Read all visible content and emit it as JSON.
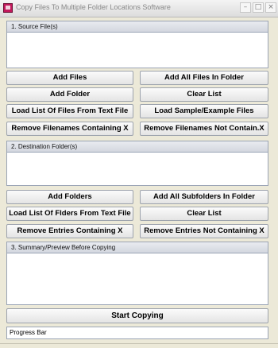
{
  "window": {
    "title": "Copy Files To Multiple Folder Locations Software",
    "controls": {
      "minimize": "–",
      "maximize": "□",
      "close": "×"
    }
  },
  "source": {
    "header": "1. Source File(s)",
    "buttons": [
      {
        "left": "Add Files",
        "right": "Add All Files In Folder"
      },
      {
        "left": "Add Folder",
        "right": "Clear List"
      },
      {
        "left": "Load List Of Files From Text File",
        "right": "Load Sample/Example Files"
      },
      {
        "left": "Remove Filenames Containing X",
        "right": "Remove Filenames Not Contain.X"
      }
    ]
  },
  "destination": {
    "header": "2. Destination Folder(s)",
    "buttons": [
      {
        "left": "Add Folders",
        "right": "Add All Subfolders In Folder"
      },
      {
        "left": "Load List Of Flders From Text File",
        "right": "Clear List"
      },
      {
        "left": "Remove Entries Containing X",
        "right": "Remove Entries Not Containing X"
      }
    ]
  },
  "summary": {
    "header": "3. Summary/Preview Before Copying"
  },
  "actions": {
    "start": "Start Copying"
  },
  "status": {
    "progress_label": "Progress Bar"
  }
}
